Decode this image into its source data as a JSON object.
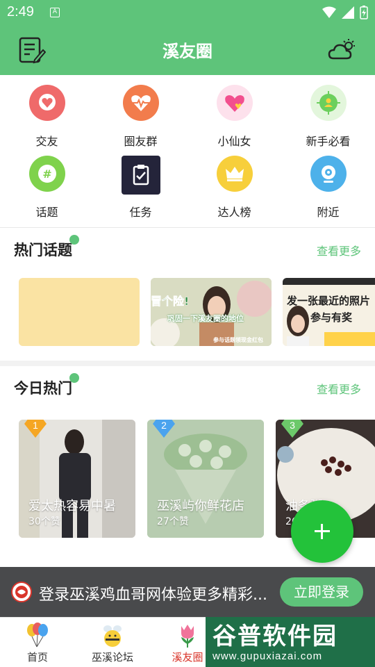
{
  "status_bar": {
    "time": "2:49",
    "notification_glyph": "A"
  },
  "header": {
    "title": "溪友圈",
    "left_icon": "note-edit-icon",
    "right_icon": "weather-icon"
  },
  "quick_menu": [
    {
      "label": "交友",
      "icon": "heart-chat-icon",
      "color": "#ef6a6a"
    },
    {
      "label": "圈友群",
      "icon": "heart-pulse-icon",
      "color": "#f27c4c"
    },
    {
      "label": "小仙女",
      "icon": "heart-icon",
      "color": "#f589b3"
    },
    {
      "label": "新手必看",
      "icon": "target-person-icon",
      "color": "#6ccf5d"
    },
    {
      "label": "话题",
      "icon": "hashtag-icon",
      "color": "#7fd24c"
    },
    {
      "label": "任务",
      "icon": "clipboard-check-icon",
      "color": "#24243a"
    },
    {
      "label": "达人榜",
      "icon": "crown-icon",
      "color": "#f7cf3b"
    },
    {
      "label": "附近",
      "icon": "camera-lens-icon",
      "color": "#4db1ea"
    }
  ],
  "hot_topics": {
    "title": "热门话题",
    "more": "查看更多",
    "cards": [
      {
        "caption": ""
      },
      {
        "caption": "冒个险!",
        "subcaption": "巩固一下溪友圈的地位",
        "footer": "参与话题领现金红包"
      },
      {
        "caption": "发一张最近的照片",
        "subcaption": "参与有奖"
      }
    ]
  },
  "today_hot": {
    "title": "今日热门",
    "more": "查看更多",
    "items": [
      {
        "rank": "1",
        "name": "爱太热容易中暑",
        "likes": "30个赞",
        "rank_color": "#f5a623"
      },
      {
        "rank": "2",
        "name": "巫溪屿你鲜花店",
        "likes": "27个赞",
        "rank_color": "#4aa3ee"
      },
      {
        "rank": "3",
        "name": "油条粥",
        "name_visible": "油条粥",
        "likes": "26个赞",
        "rank_color": "#6cc96a"
      }
    ]
  },
  "login_banner": {
    "text": "登录巫溪鸡血哥网体验更多精彩...",
    "button": "立即登录"
  },
  "tabbar": [
    {
      "label": "首页",
      "icon": "balloons-icon"
    },
    {
      "label": "巫溪论坛",
      "icon": "bee-icon"
    },
    {
      "label": "溪友圈",
      "icon": "tulip-icon",
      "active": true
    }
  ],
  "watermark": {
    "big": "谷普软件园",
    "small": "www.gupuxiazai.com"
  },
  "colors": {
    "brand": "#5ec47a",
    "fab": "#23c23a",
    "banner": "#494a4c"
  }
}
